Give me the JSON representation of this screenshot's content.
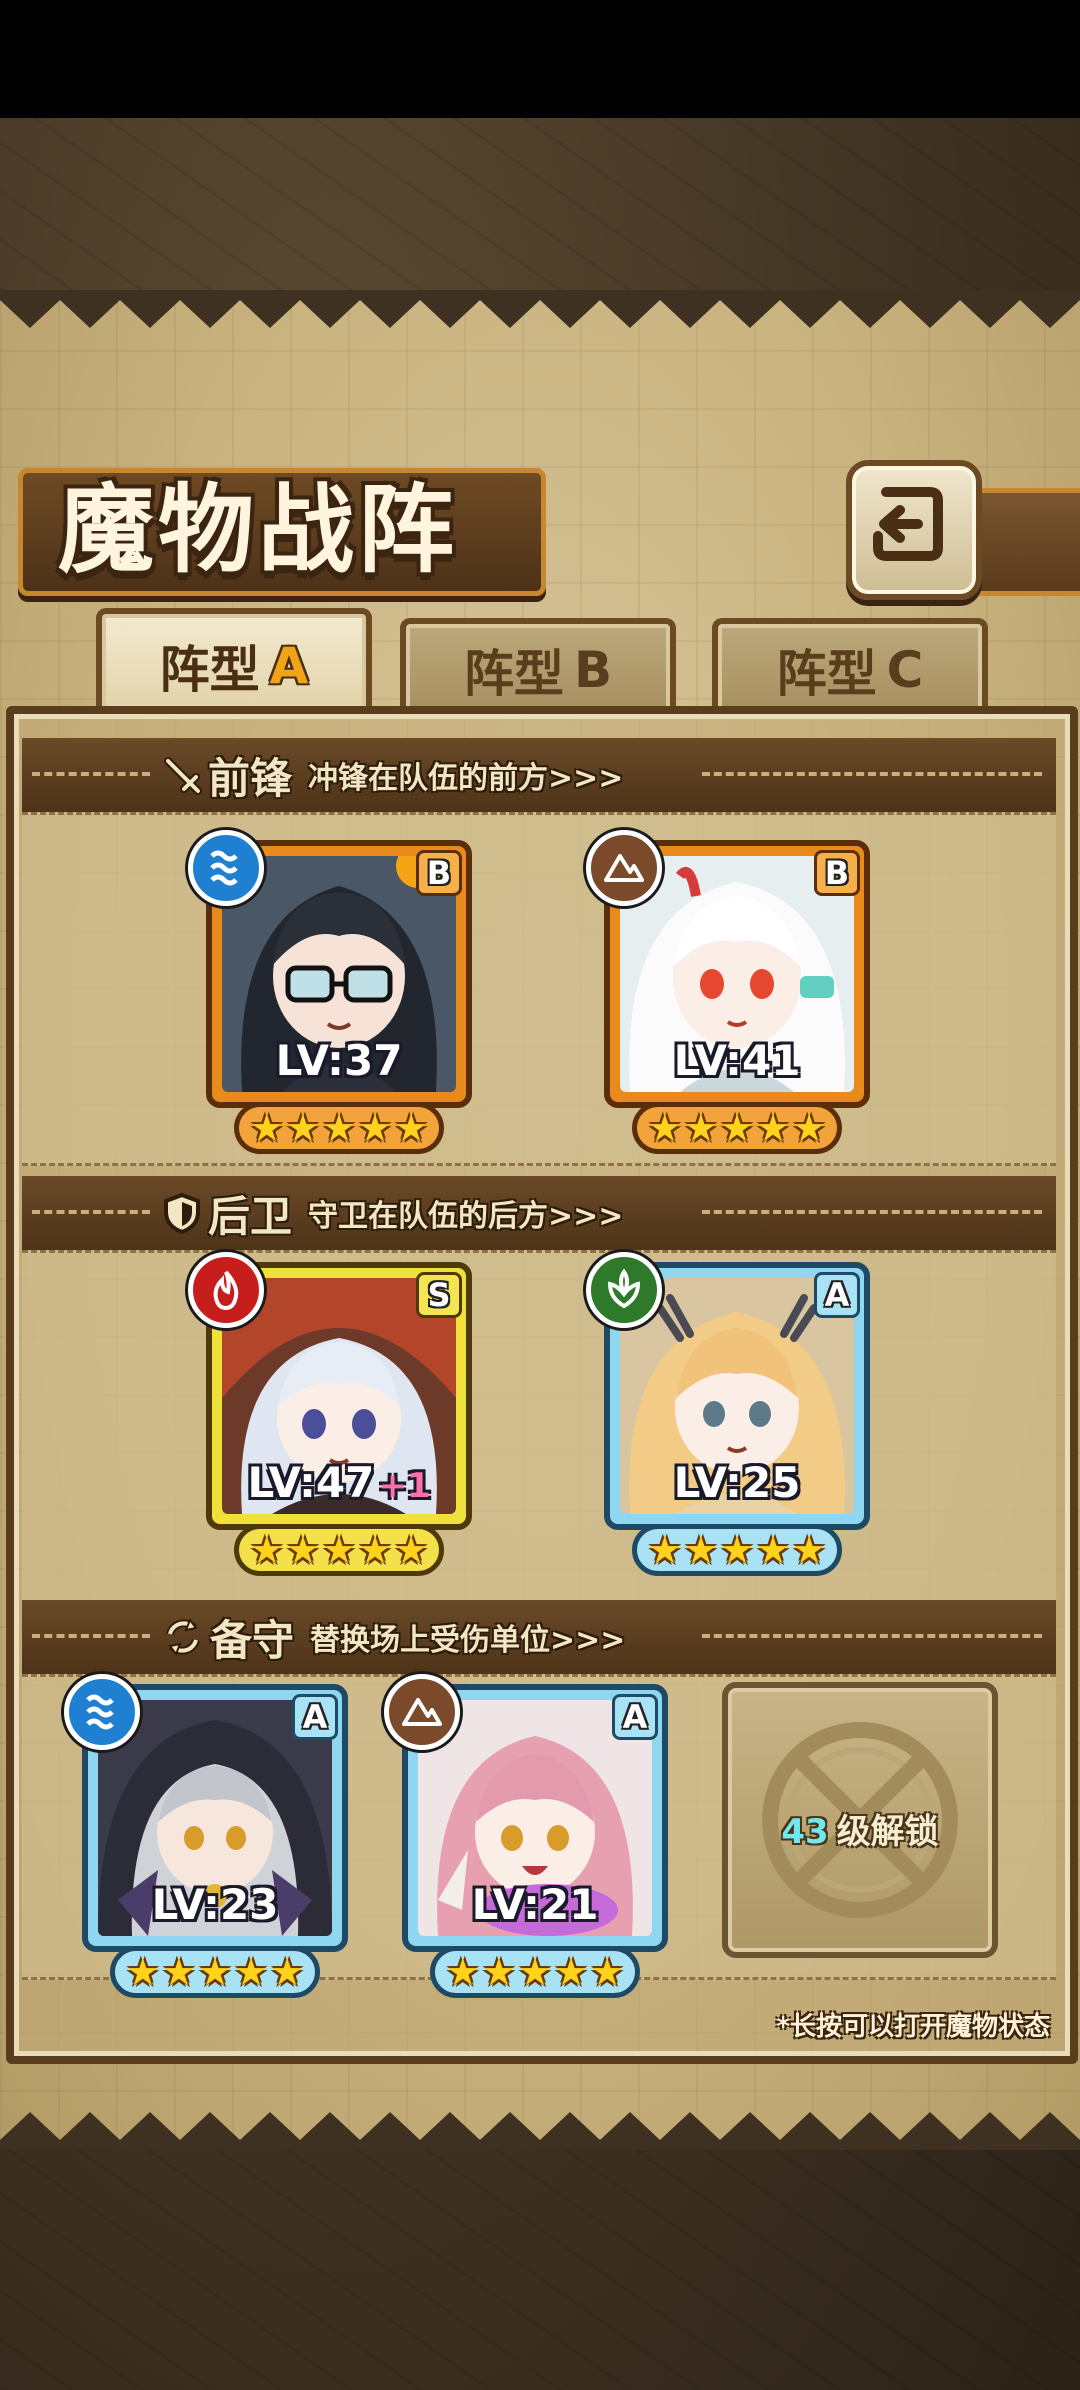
{
  "title": "魔物战阵",
  "tabs": [
    {
      "label": "阵型",
      "letter": "A",
      "active": true
    },
    {
      "label": "阵型",
      "letter": "B",
      "active": false
    },
    {
      "label": "阵型",
      "letter": "C",
      "active": false
    }
  ],
  "sections": {
    "vanguard": {
      "name": "前锋",
      "desc": "冲锋在队伍的前方>>>",
      "icon": "sword-icon"
    },
    "rear": {
      "name": "后卫",
      "desc": "守卫在队伍的后方>>>",
      "icon": "shield-icon"
    },
    "reserve": {
      "name": "备守",
      "desc": "替换场上受伤单位>>>",
      "icon": "swap-icon"
    }
  },
  "units": {
    "v1": {
      "lv": "LV:37",
      "rank": "B",
      "element": "water",
      "stars": 5
    },
    "v2": {
      "lv": "LV:41",
      "rank": "B",
      "element": "earth",
      "stars": 5
    },
    "r1": {
      "lv": "LV:47",
      "plus": "+1",
      "rank": "S",
      "element": "fire",
      "stars": 5
    },
    "r2": {
      "lv": "LV:25",
      "rank": "A",
      "element": "wind",
      "stars": 5
    },
    "b1": {
      "lv": "LV:23",
      "rank": "A",
      "element": "water",
      "stars": 5
    },
    "b2": {
      "lv": "LV:21",
      "rank": "A",
      "element": "earth",
      "stars": 5
    }
  },
  "locked_slot": {
    "level": "43",
    "text": "级解锁"
  },
  "hint": "*长按可以打开魔物状态",
  "colors": {
    "frame_orange": "#e98a1c",
    "frame_yellow": "#f0e03a",
    "frame_blue": "#8fd6f0",
    "accent": "#f0a418"
  }
}
